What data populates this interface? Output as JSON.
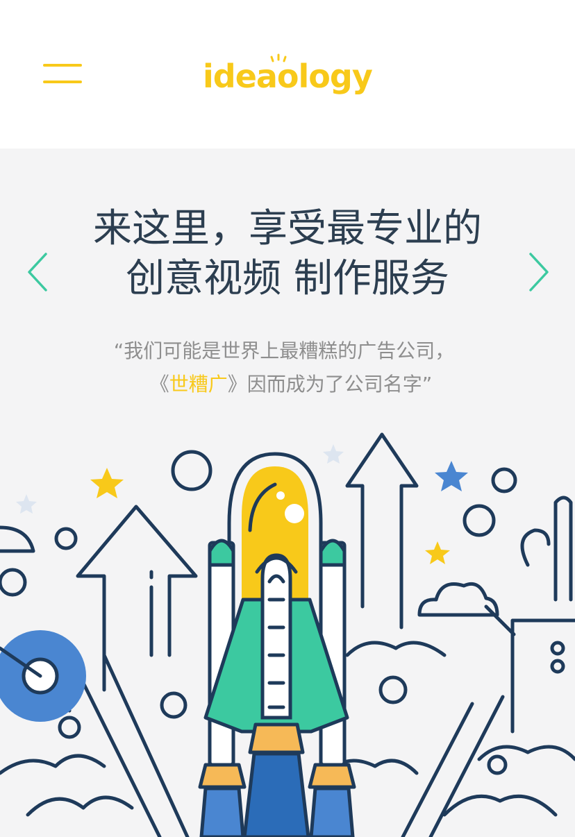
{
  "header": {
    "logo_text": "ideaology",
    "menu_icon": "hamburger-menu-icon",
    "brand_color": "#f8c91a"
  },
  "hero": {
    "title_line1": "来这里，享受最专业的",
    "title_line2": "创意视频 制作服务",
    "quote_line1": "“我们可能是世界上最糟糕的广告公司，",
    "quote_line2_prefix": "《",
    "quote_line2_highlight": "世糟广",
    "quote_line2_suffix": "》因而成为了公司名字”",
    "prev_icon": "chevron-left-icon",
    "next_icon": "chevron-right-icon",
    "arrow_color": "#3cc9a0",
    "background_color": "#f4f4f5",
    "illustration": "rocket-launch-illustration"
  }
}
